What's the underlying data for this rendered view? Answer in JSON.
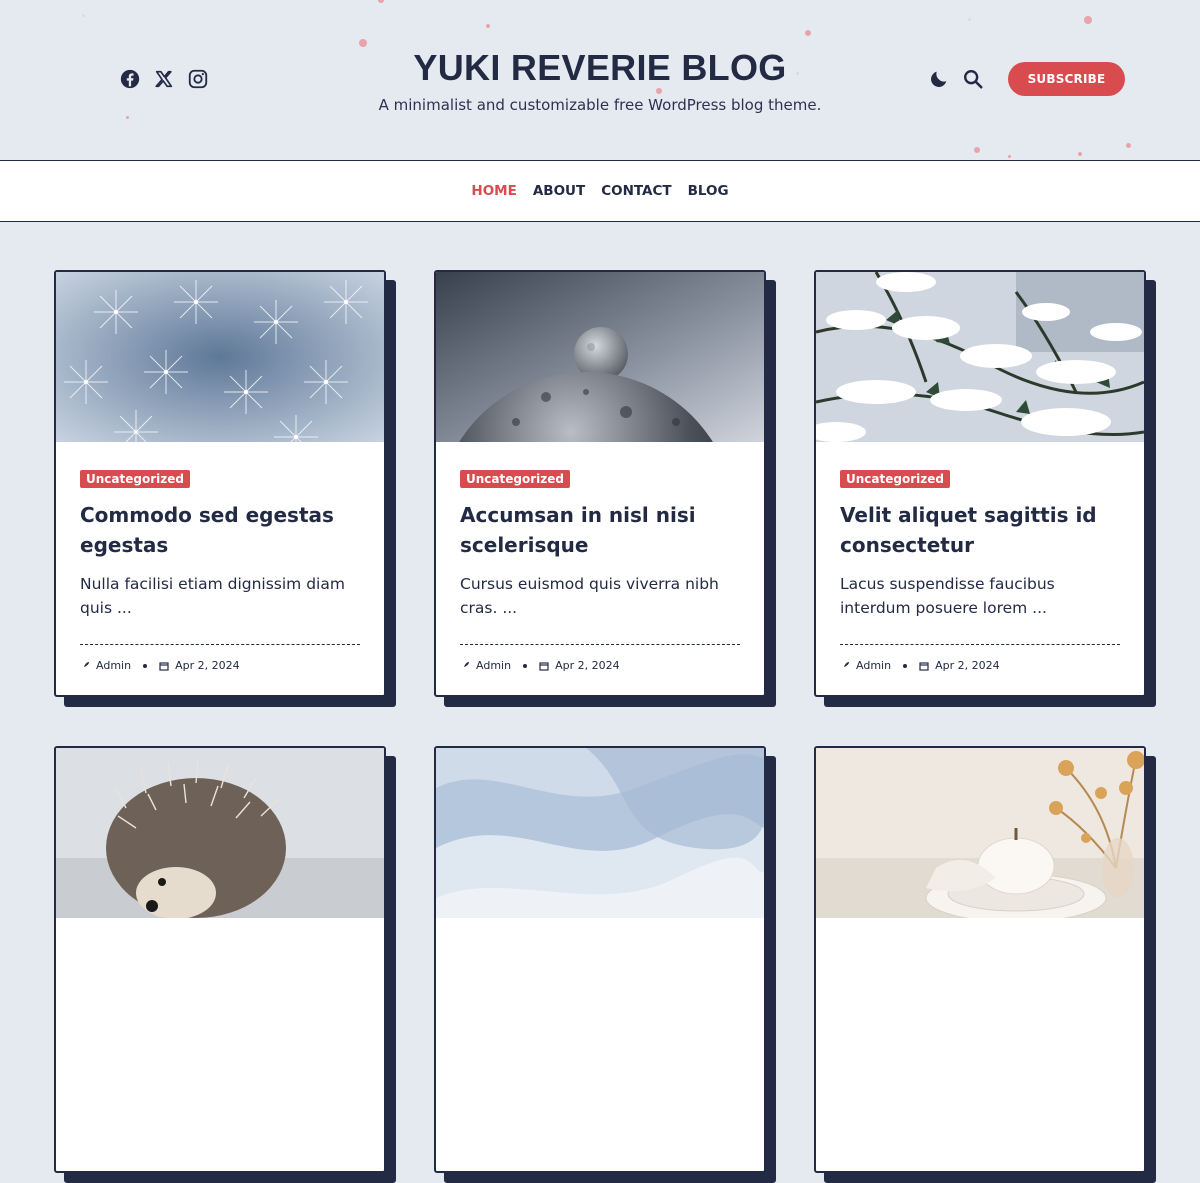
{
  "site": {
    "title": "YUKI REVERIE BLOG",
    "tagline": "A minimalist and customizable free WordPress blog theme."
  },
  "header": {
    "social_icons": [
      "facebook-icon",
      "x-twitter-icon",
      "instagram-icon"
    ],
    "action_icons": [
      "moon-icon",
      "search-icon"
    ],
    "subscribe_label": "SUBSCRIBE"
  },
  "nav": {
    "items": [
      {
        "label": "HOME",
        "active": true
      },
      {
        "label": "ABOUT",
        "active": false
      },
      {
        "label": "CONTACT",
        "active": false
      },
      {
        "label": "BLOG",
        "active": false
      }
    ]
  },
  "colors": {
    "background": "#e5e9f0",
    "accent": "#d84b4f",
    "dark": "#232a44",
    "card": "#ffffff"
  },
  "posts": [
    {
      "image": "dandelion-seeds",
      "category": "Uncategorized",
      "title": "Commodo sed egestas egestas",
      "excerpt": "Nulla facilisi etiam dignissim diam quis ...",
      "author": "Admin",
      "date": "Apr 2, 2024"
    },
    {
      "image": "moon-and-planet",
      "category": "Uncategorized",
      "title": "Accumsan in nisl nisi scelerisque",
      "excerpt": "Cursus euismod quis viverra nibh cras. ...",
      "author": "Admin",
      "date": "Apr 2, 2024"
    },
    {
      "image": "snowy-pine-branches",
      "category": "Uncategorized",
      "title": "Velit aliquet sagittis id consectetur",
      "excerpt": "Lacus suspendisse faucibus interdum posuere lorem ...",
      "author": "Admin",
      "date": "Apr 2, 2024"
    },
    {
      "image": "hedgehog"
    },
    {
      "image": "abstract-blue-waves"
    },
    {
      "image": "pumpkin-on-plates"
    }
  ]
}
